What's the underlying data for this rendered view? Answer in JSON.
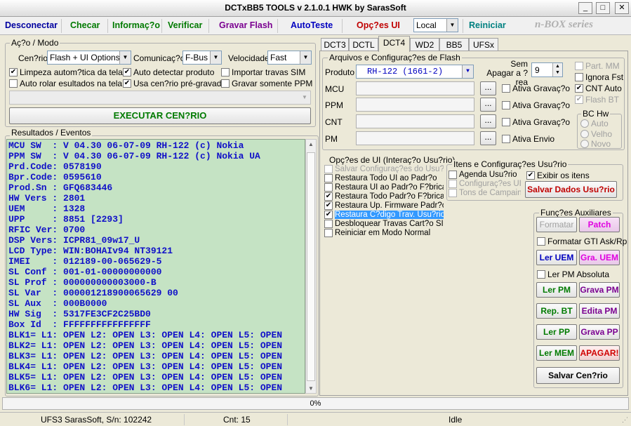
{
  "window": {
    "title": "DCTxBB5 TOOLS v 2.1.0.1 HWK by SarasSoft",
    "minimize": "_",
    "maximize": "□",
    "close": "✕"
  },
  "menu": {
    "items": [
      "Desconectar",
      "Checar",
      "Informaç?o",
      "Verificar",
      "Gravar Flash",
      "AutoTeste",
      "Opç?es UI"
    ],
    "colors": [
      "#0000a0",
      "#007a00",
      "#007a00",
      "#007a00",
      "#7a0090",
      "#0000c0",
      "#c00000"
    ],
    "locale": "Local",
    "restart": "Reiniciar",
    "logo": "n-BOX series"
  },
  "action": {
    "group": "Aç?o / Modo",
    "scenario_label": "Cen?rio",
    "scenario_value": "Flash + UI Options",
    "comm_label": "Comunicaç?o",
    "comm_value": "F-Bus",
    "speed_label": "Velocidade",
    "speed_value": "Fast",
    "opt_clear": "Limpeza autom?tica da tela",
    "opt_autodetect": "Auto detectar produto",
    "opt_import": "Importar travas SIM",
    "opt_autoscroll": "Auto rolar esultados na tela",
    "opt_prerecorded": "Usa cen?rio pré-gravado",
    "opt_ppm_only": "Gravar somente PPM",
    "execute": "EXECUTAR CEN?RIO"
  },
  "results": {
    "group": "Resultados / Eventos",
    "lines": [
      "MCU SW  : V 04.30 06-07-09 RH-122 (c) Nokia",
      "PPM SW  : V 04.30 06-07-09 RH-122 (c) Nokia UA",
      "Prd.Code: 0578190",
      "Bpr.Code: 0595610",
      "Prod.Sn : GFQ683446",
      "HW Vers : 2801",
      "UEM     : 1328",
      "UPP     : 8851 [2293]",
      "RFIC Ver: 0700",
      "DSP Vers: ICPR81_09w17_U",
      "LCD Type: WIN:BOHAIv94 NT39121",
      "IMEI    : 012189-00-065629-5",
      "SL Conf : 001-01-00000000000",
      "SL Prof : 000000000003000-B",
      "SL Var  : 000001218900065629 00",
      "SL Aux  : 000B0000",
      "HW Sig  : 5317FE3CF2C25BD0",
      "Box Id  : FFFFFFFFFFFFFFFF",
      "BLK1= L1: OPEN L2: OPEN L3: OPEN L4: OPEN L5: OPEN",
      "BLK2= L1: OPEN L2: OPEN L3: OPEN L4: OPEN L5: OPEN",
      "BLK3= L1: OPEN L2: OPEN L3: OPEN L4: OPEN L5: OPEN",
      "BLK4= L1: OPEN L2: OPEN L3: OPEN L4: OPEN L5: OPEN",
      "BLK5= L1: OPEN L2: OPEN L3: OPEN L4: OPEN L5: OPEN",
      "BLK6= L1: OPEN L2: OPEN L3: OPEN L4: OPEN L5: OPEN"
    ]
  },
  "tabs": [
    "DCT3",
    "DCTL",
    "DCT4",
    "WD2",
    "BB5",
    "UFSx"
  ],
  "active_tab": "DCT4",
  "flash": {
    "group": "Arquivos e Configuraç?es de Flash",
    "product_label": "Produto",
    "product_value": "RH-122  (1661-2)",
    "rows": [
      {
        "label": "MCU",
        "browse": "...",
        "check": "Ativa Gravaç?o"
      },
      {
        "label": "PPM",
        "browse": "...",
        "check": "Ativa Gravaç?o"
      },
      {
        "label": "CNT",
        "browse": "...",
        "check": "Ativa Gravaç?o"
      },
      {
        "label": "PM",
        "browse": "...",
        "check": "Ativa Envio"
      }
    ],
    "nowipe_label": "Sem Apagar a ?rea",
    "nowipe_value": "9",
    "part_mm": "Part. MM",
    "ignore_fst": "Ignora Fst",
    "cnt_auto": "CNT Auto",
    "flash_bt": "Flash BT",
    "hw_group": "BC Hw",
    "hw_opts": [
      "Auto",
      "Velho",
      "Novo"
    ]
  },
  "ui_options": {
    "group": "Opç?es de UI (Interaç?o Usu?rio)",
    "items": [
      {
        "text": "Salvar Configuraç?es do Usu?rio",
        "checked": false,
        "disabled": true
      },
      {
        "text": "Restaura Todo UI ao Padr?o",
        "checked": false,
        "disabled": false
      },
      {
        "text": "Restaura UI ao Padr?o F?brica",
        "checked": false,
        "disabled": false
      },
      {
        "text": "Restaura Todo Padr?o F?brica",
        "checked": true,
        "disabled": false
      },
      {
        "text": "Restaura Up. Firmware Padr?o",
        "checked": true,
        "disabled": false
      },
      {
        "text": "Restaura C?digo Trav. Usu?rio",
        "checked": true,
        "disabled": false,
        "selected": true
      },
      {
        "text": "Desbloquear Travas Cart?o SIM",
        "checked": false,
        "disabled": false
      },
      {
        "text": "Reiniciar em Modo Normal",
        "checked": false,
        "disabled": false
      }
    ]
  },
  "user_items": {
    "group": "Itens e Configuraç?es Usu?rio",
    "agenda": "Agenda Usu?rio",
    "config_ui": "Configuraç?es UI",
    "ringtones": "Tons de Campainha",
    "show_items": "Exibir os itens",
    "save_data": "Salvar Dados Usu?rio"
  },
  "aux": {
    "group": "Funç?es Auxiliares",
    "format": "Formatar",
    "patch": "Patch",
    "format_gti": "Formatar GTI Ask/Rp",
    "read_uem": "Ler UEM",
    "write_uem": "Gra. UEM",
    "read_pm_abs": "Ler PM Absoluta",
    "read_pm": "Ler PM",
    "write_pm": "Grava PM",
    "rep_bt": "Rep. BT",
    "edit_pm": "Edita PM",
    "read_pp": "Ler PP",
    "write_pp": "Grava PP",
    "read_mem": "Ler MEM",
    "erase": "APAGAR!",
    "save_scenario": "Salvar Cen?rio"
  },
  "progress": {
    "text": "0%",
    "value": 0
  },
  "status": {
    "serial": "UFS3 SarasSoft, S/n: 102242",
    "count": "Cnt: 15",
    "state": "Idle"
  }
}
